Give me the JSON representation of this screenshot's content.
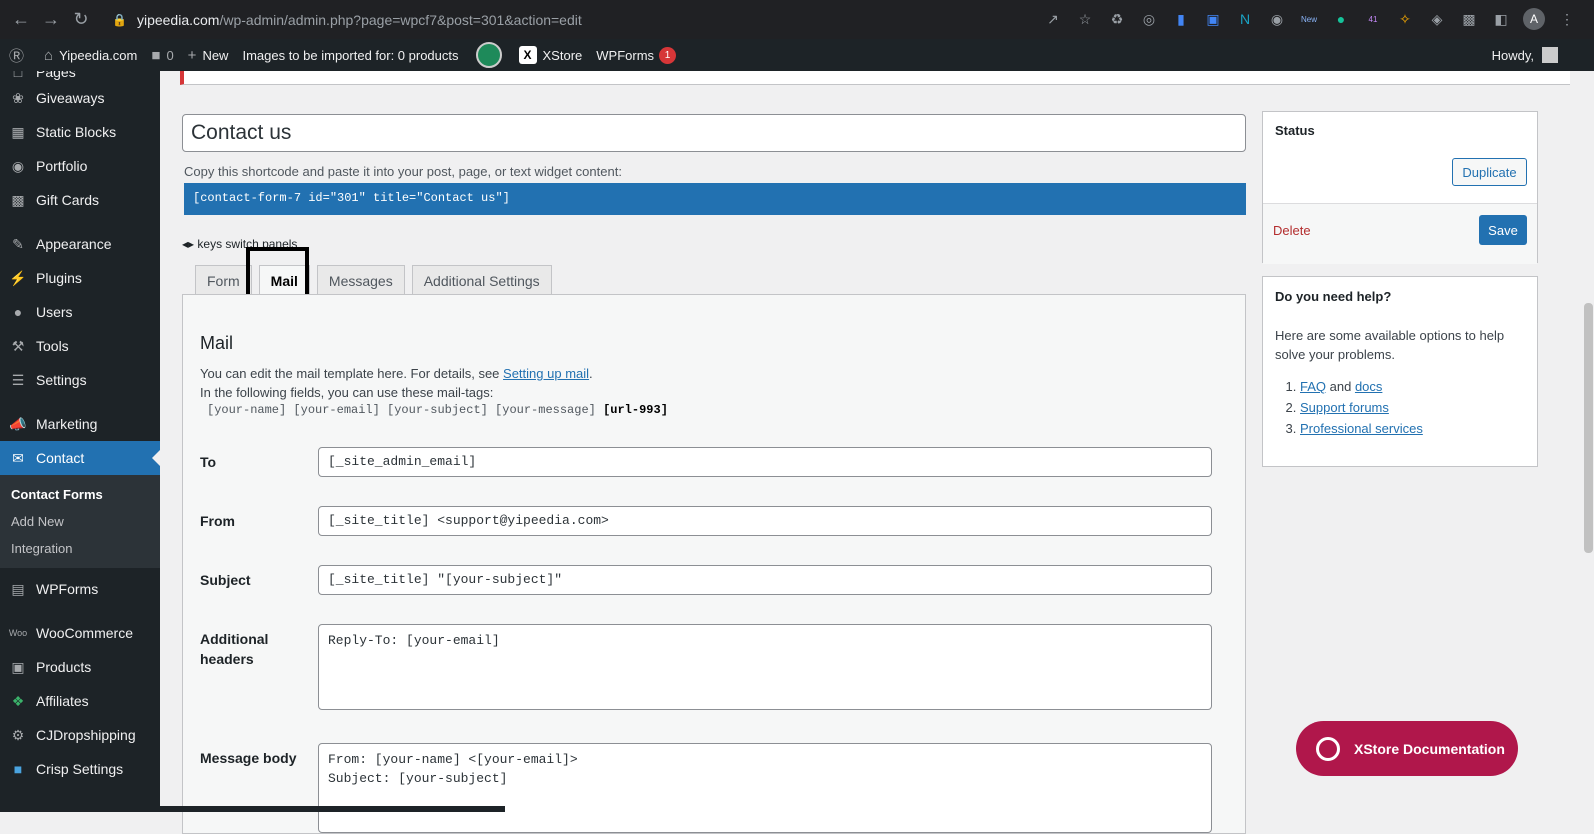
{
  "browser": {
    "url_host": "yipeedia.com",
    "url_path": "/wp-admin/admin.php?page=wpcf7&post=301&action=edit",
    "avatar_letter": "A",
    "ext_new_badge": "New",
    "ext_count_badge": "41"
  },
  "adminbar": {
    "site_name": "Yipeedia.com",
    "comments_count": "0",
    "new_label": "New",
    "images_text": "Images to be imported for: 0 products",
    "xstore_label": "XStore",
    "wpforms_label": "WPForms",
    "wpforms_badge": "1",
    "howdy": "Howdy,"
  },
  "sidebar": {
    "top_cut": "Pages",
    "items": [
      {
        "label": "Giveaways",
        "icon": "gift-icon"
      },
      {
        "label": "Static Blocks",
        "icon": "blocks-icon"
      },
      {
        "label": "Portfolio",
        "icon": "portfolio-icon"
      },
      {
        "label": "Gift Cards",
        "icon": "giftcard-icon"
      },
      {
        "label": "Appearance",
        "icon": "paintbrush-icon"
      },
      {
        "label": "Plugins",
        "icon": "plugin-icon"
      },
      {
        "label": "Users",
        "icon": "user-icon"
      },
      {
        "label": "Tools",
        "icon": "wrench-icon"
      },
      {
        "label": "Settings",
        "icon": "settings-icon"
      },
      {
        "label": "Marketing",
        "icon": "megaphone-icon"
      },
      {
        "label": "Contact",
        "icon": "envelope-icon"
      },
      {
        "label": "WPForms",
        "icon": "form-icon"
      },
      {
        "label": "WooCommerce",
        "icon": "woo-icon"
      },
      {
        "label": "Products",
        "icon": "archive-icon"
      },
      {
        "label": "Affiliates",
        "icon": "affiliates-icon"
      },
      {
        "label": "CJDropshipping",
        "icon": "gear-icon"
      },
      {
        "label": "Crisp Settings",
        "icon": "chat-icon"
      }
    ],
    "submenu": [
      "Contact Forms",
      "Add New",
      "Integration"
    ]
  },
  "form": {
    "title": "Contact us",
    "shortcode_label": "Copy this shortcode and paste it into your post, page, or text widget content:",
    "shortcode": "[contact-form-7 id=\"301\" title=\"Contact us\"]",
    "keys_hint": "keys switch panels",
    "tabs": [
      "Form",
      "Mail",
      "Messages",
      "Additional Settings"
    ]
  },
  "mail": {
    "heading": "Mail",
    "desc_prefix": "You can edit the mail template here. For details, see ",
    "desc_link": "Setting up mail",
    "desc_suffix": ".",
    "desc_line2": "In the following fields, you can use these mail-tags:",
    "tags": "[your-name] [your-email] [your-subject] [your-message] ",
    "tag_bold": "[url-993]",
    "to_label": "To",
    "to_value": "[_site_admin_email]",
    "from_label": "From",
    "from_value": "[_site_title] <support@yipeedia.com>",
    "subject_label": "Subject",
    "subject_value": "[_site_title] \"[your-subject]\"",
    "headers_label": "Additional headers",
    "headers_value": "Reply-To: [your-email]",
    "body_label": "Message body",
    "body_value": "From: [your-name] <[your-email]>\nSubject: [your-subject]"
  },
  "status": {
    "heading": "Status",
    "duplicate": "Duplicate",
    "delete": "Delete",
    "save": "Save"
  },
  "help": {
    "heading": "Do you need help?",
    "text": "Here are some available options to help solve your problems.",
    "faq": "FAQ",
    "and": " and ",
    "docs": "docs",
    "forums": "Support forums",
    "services": "Professional services"
  },
  "xstore_doc": "XStore Documentation"
}
